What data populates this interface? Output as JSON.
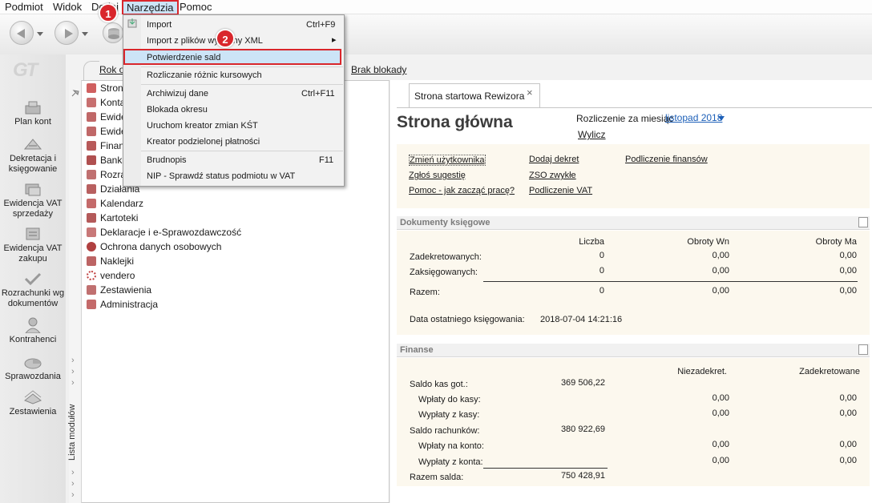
{
  "menubar": {
    "items": [
      "Podmiot",
      "Widok",
      "Dodaj",
      "Narzędzia",
      "Pomoc"
    ]
  },
  "topbar": {
    "links": [
      "Rok o",
      "Brak blokady"
    ]
  },
  "leftnav": {
    "logo": "GT",
    "items": [
      "Plan kont",
      "Dekretacja i księgowanie",
      "Ewidencja VAT sprzedaży",
      "Ewidencja VAT zakupu",
      "Rozrachunki wg dokumentów",
      "Kontrahenci",
      "Sprawozdania",
      "Zestawienia"
    ]
  },
  "modules": {
    "vertical_label": "Lista modułów",
    "items": [
      "Stron",
      "Konta",
      "Ewide",
      "Ewide",
      "Finan",
      "Bank",
      "Rozra",
      "Działania",
      "Kalendarz",
      "Kartoteki",
      "Deklaracje i e-Sprawozdawczość",
      "Ochrona danych osobowych",
      "Naklejki",
      "vendero",
      "Zestawienia",
      "Administracja"
    ]
  },
  "dropdown": {
    "items": [
      {
        "label": "Import",
        "shortcut": "Ctrl+F9"
      },
      {
        "label": "Import z plików wymiany XML",
        "shortcut": "▸"
      },
      {
        "label": "Potwierdzenie sald",
        "shortcut": ""
      },
      {
        "label": "Rozliczanie różnic kursowych",
        "shortcut": ""
      },
      {
        "label": "Archiwizuj dane",
        "shortcut": "Ctrl+F11"
      },
      {
        "label": "Blokada okresu",
        "shortcut": ""
      },
      {
        "label": "Uruchom kreator zmian KŚT",
        "shortcut": ""
      },
      {
        "label": "Kreator podzielonej płatności",
        "shortcut": ""
      },
      {
        "label": "Brudnopis",
        "shortcut": "F11"
      },
      {
        "label": "NIP - Sprawdź status podmiotu w VAT",
        "shortcut": ""
      }
    ]
  },
  "badges": [
    "1",
    "2"
  ],
  "tab": {
    "label": "Strona startowa Rewizora",
    "close": "×"
  },
  "main": {
    "title": "Strona główna",
    "month_label": "Rozliczenie za miesiąc",
    "month_value": "listopad 2018",
    "recalc_link": "Wylicz",
    "quick_links": [
      "Zmień użytkownika",
      "Zgłoś sugestię",
      "Pomoc - jak zacząć pracę?",
      "Dodaj dekret",
      "ZSO zwykłe",
      "Podliczenie VAT",
      "Podliczenie finansów"
    ]
  },
  "docs": {
    "title": "Dokumenty księgowe",
    "headers": [
      "Liczba",
      "Obroty Wn",
      "Obroty Ma"
    ],
    "rows": [
      {
        "label": "Zadekretowanych:",
        "count": "0",
        "wn": "0,00",
        "ma": "0,00"
      },
      {
        "label": "Zaksięgowanych:",
        "count": "0",
        "wn": "0,00",
        "ma": "0,00"
      },
      {
        "label": "Razem:",
        "count": "0",
        "wn": "0,00",
        "ma": "0,00"
      }
    ],
    "last_label": "Data ostatniego księgowania:",
    "last_value": "2018-07-04 14:21:16"
  },
  "finance": {
    "title": "Finanse",
    "headers": [
      "Niezadekret.",
      "Zadekretowane"
    ],
    "rows": [
      {
        "label": "Saldo kas got.:",
        "amount": "369 506,22",
        "nz": "",
        "z": ""
      },
      {
        "label": "Wpłaty do kasy:",
        "amount": "",
        "nz": "0,00",
        "z": "0,00"
      },
      {
        "label": "Wypłaty z kasy:",
        "amount": "",
        "nz": "0,00",
        "z": "0,00"
      },
      {
        "label": "Saldo rachunków:",
        "amount": "380 922,69",
        "nz": "",
        "z": ""
      },
      {
        "label": "Wpłaty na konto:",
        "amount": "",
        "nz": "0,00",
        "z": "0,00"
      },
      {
        "label": "Wypłaty z konta:",
        "amount": "",
        "nz": "0,00",
        "z": "0,00"
      },
      {
        "label": "Razem salda:",
        "amount": "750 428,91",
        "nz": "",
        "z": ""
      }
    ]
  }
}
